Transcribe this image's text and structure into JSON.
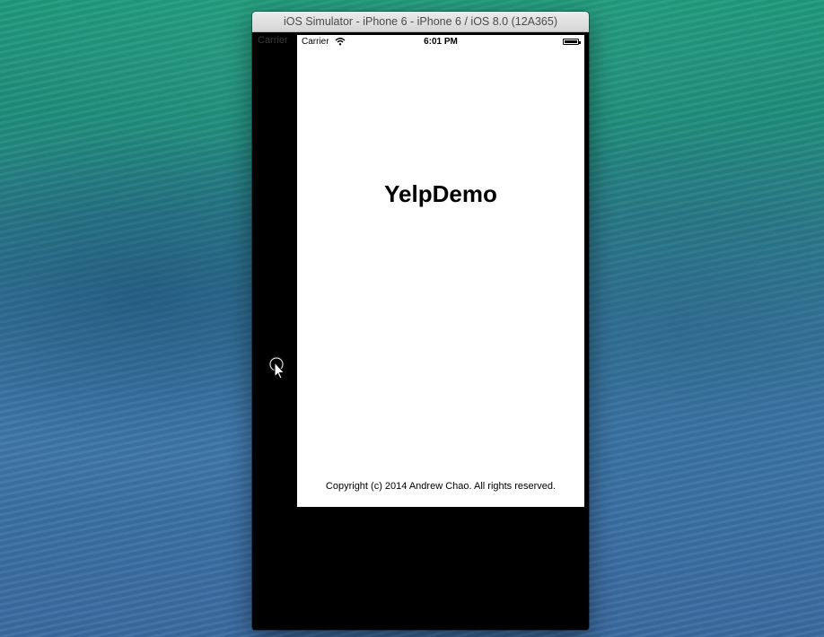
{
  "window": {
    "title": "iOS Simulator - iPhone 6 - iPhone 6 / iOS 8.0 (12A365)"
  },
  "behind_screen": {
    "carrier": "Carrier"
  },
  "status_bar": {
    "carrier": "Carrier",
    "time": "6:01 PM",
    "wifi_icon": "wifi-icon",
    "battery_icon": "battery-icon"
  },
  "app": {
    "title": "YelpDemo",
    "copyright": "Copyright (c) 2014 Andrew Chao. All rights reserved."
  },
  "cursor": {
    "icon": "touch-pointer-icon"
  },
  "colors": {
    "screen_background": "#ffffff",
    "simulator_frame": "#000000",
    "desktop_top": "#1f9a7c",
    "desktop_bottom": "#3a6aa0"
  }
}
